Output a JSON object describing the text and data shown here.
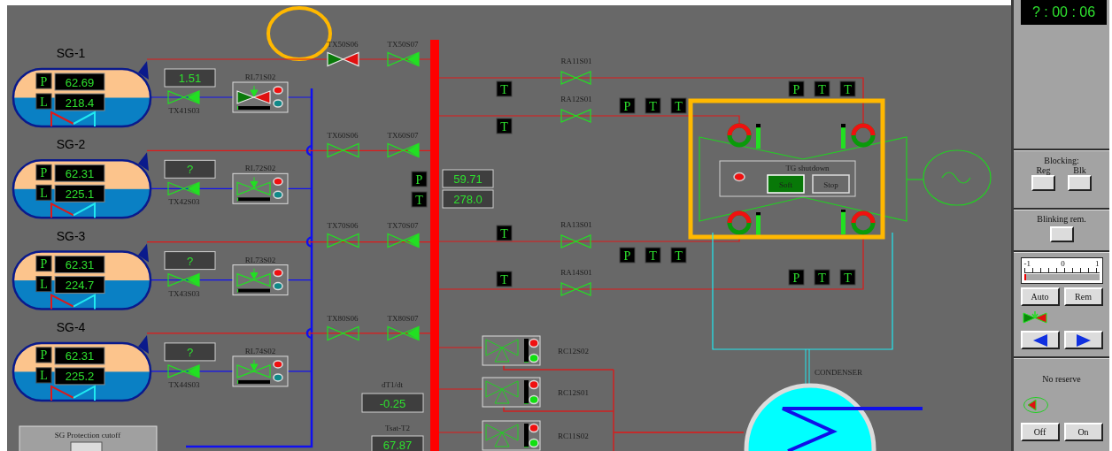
{
  "steam_generators": [
    {
      "name": "SG-1",
      "pressure_label": "P",
      "pressure": "62.69",
      "level_label": "L",
      "level_reading": "218.4",
      "flow": "1.51",
      "valve": {
        "tag": "TX41S03",
        "kind": "filled_right"
      },
      "regulator": {
        "tag": "RL71S02",
        "kind": "split",
        "level": 0.03
      }
    },
    {
      "name": "SG-2",
      "pressure_label": "P",
      "pressure": "62.31",
      "level_label": "L",
      "level_reading": "225.1",
      "flow": "?",
      "valve": {
        "tag": "TX42S03",
        "kind": "filled_right"
      },
      "regulator": {
        "tag": "RL72S02",
        "kind": "outline",
        "level": 0.03
      }
    },
    {
      "name": "SG-3",
      "pressure_label": "P",
      "pressure": "62.31",
      "level_label": "L",
      "level_reading": "224.7",
      "flow": "?",
      "valve": {
        "tag": "TX43S03",
        "kind": "filled_right"
      },
      "regulator": {
        "tag": "RL73S02",
        "kind": "outline",
        "level": 0.03
      }
    },
    {
      "name": "SG-4",
      "pressure_label": "P",
      "pressure": "62.31",
      "level_label": "L",
      "level_reading": "225.2",
      "flow": "?",
      "valve": {
        "tag": "TX44S03",
        "kind": "filled_right"
      },
      "regulator": {
        "tag": "RL74S02",
        "kind": "outline",
        "level": 0.03
      }
    }
  ],
  "header_valves": [
    {
      "first": {
        "tag": "TX50S06",
        "kind": "split"
      },
      "second": {
        "tag": "TX50S07",
        "kind": "filled_right"
      }
    },
    {
      "first": {
        "tag": "TX60S06",
        "kind": "outline"
      },
      "second": {
        "tag": "TX60S07",
        "kind": "filled_right"
      }
    },
    {
      "first": {
        "tag": "TX70S06",
        "kind": "outline"
      },
      "second": {
        "tag": "TX70S07",
        "kind": "filled_right"
      }
    },
    {
      "first": {
        "tag": "TX80S06",
        "kind": "outline"
      },
      "second": {
        "tag": "TX80S07",
        "kind": "filled_right"
      }
    }
  ],
  "header": {
    "pressure_label": "P",
    "pressure": "59.71",
    "temperature_label": "T",
    "temperature": "278.0"
  },
  "steam_lines": [
    {
      "tag": "RA11S01",
      "sensor": "T"
    },
    {
      "tag": "RA12S01",
      "sensor": "T"
    },
    {
      "tag": "RA13S01",
      "sensor": "T"
    },
    {
      "tag": "RA14S01",
      "sensor": "T"
    }
  ],
  "sensor_groups": [
    [
      "P",
      "T",
      "T"
    ],
    [
      "P",
      "T",
      "T"
    ],
    [
      "P",
      "T",
      "T"
    ],
    [
      "P",
      "T",
      "T"
    ]
  ],
  "turbine": {
    "panel_title": "TG shutdown",
    "buttons": [
      {
        "label": "Soft",
        "selected": true
      },
      {
        "label": "Stop",
        "selected": false
      }
    ],
    "gauges": [
      {
        "level": 0.85
      },
      {
        "level": 0.85
      },
      {
        "level": 0.88
      },
      {
        "level": 0.9
      }
    ]
  },
  "control_valves": [
    {
      "tag": "RC12S02",
      "level": 0.03
    },
    {
      "tag": "RC12S01",
      "level": 0.03
    },
    {
      "tag": "RC11S02",
      "level": 0.03
    }
  ],
  "rates": [
    {
      "label": "dT1/dt",
      "value": "-0.25"
    },
    {
      "label": "Tsat-T2",
      "value": "67.87"
    }
  ],
  "protection": {
    "title": "SG Protection cutoff"
  },
  "condenser": {
    "label": "CONDENSER"
  },
  "side_panel": {
    "clock": "? : 00 : 06",
    "blocking": {
      "title": "Blocking:",
      "buttons": [
        "Reg",
        "Blk"
      ]
    },
    "blinking": {
      "title": "Blinking rem."
    },
    "scale": {
      "ticks": [
        "-1",
        "0",
        "1"
      ],
      "level": 0.03
    },
    "mode_buttons": [
      "Auto",
      "Rem"
    ],
    "reserve": {
      "status": "No reserve"
    },
    "power_buttons": [
      "Off",
      "On"
    ]
  }
}
